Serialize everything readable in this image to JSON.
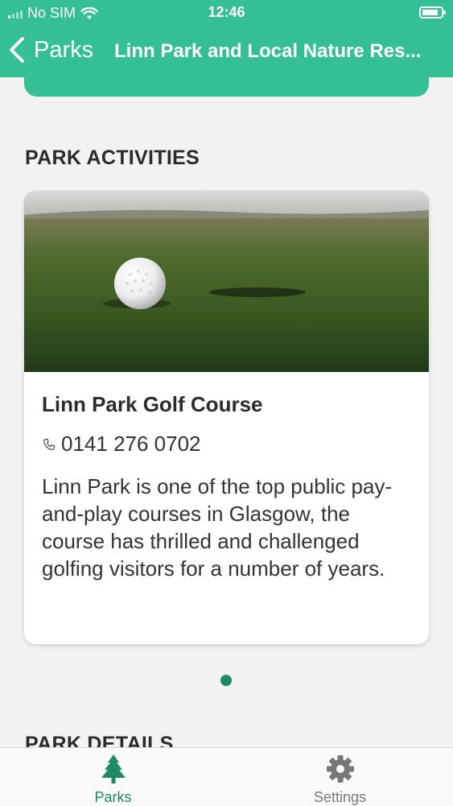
{
  "status_bar": {
    "carrier": "No SIM",
    "time": "12:46"
  },
  "nav": {
    "back_label": "Parks",
    "title": "Linn Park and Local Nature Res..."
  },
  "sections": {
    "activities_heading": "PARK ACTIVITIES",
    "details_heading": "PARK DETAILS"
  },
  "activity_card": {
    "title": "Linn Park Golf Course",
    "phone": "0141 276 0702",
    "description": "Linn Park is one of the top public pay-and-play courses in Glasgow, the course has thrilled and challenged golfing visitors for a number of years."
  },
  "pager": {
    "count": 1,
    "active_index": 0
  },
  "tabbar": {
    "items": [
      {
        "label": "Parks",
        "icon": "tree-icon",
        "active": true
      },
      {
        "label": "Settings",
        "icon": "gear-icon",
        "active": false
      }
    ]
  },
  "colors": {
    "header_green": "#34bf95",
    "active_green": "#1f8a66",
    "background": "#f2f2f2"
  }
}
